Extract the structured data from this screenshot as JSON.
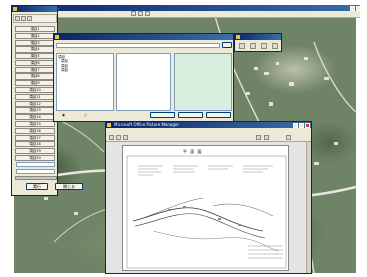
{
  "main_window": {
    "title": "地図情報閲覧システム",
    "menu": [],
    "side_tabs": [
      "項目1",
      "項目2",
      "項目3",
      "項目4",
      "項目5",
      "項目6",
      "項目7",
      "項目8",
      "項目9",
      "項目10",
      "項目11",
      "項目12",
      "項目13",
      "項目14",
      "項目15",
      "項目16",
      "項目17",
      "項目18",
      "項目19",
      "項目20"
    ],
    "left_field_values": [
      "",
      ""
    ],
    "ok_label": "実行",
    "close_label": "閉じる"
  },
  "dialog": {
    "title": "",
    "path_value": "",
    "tree_items": [
      "項目",
      "項目",
      "項目",
      "項目"
    ],
    "selected_item": "",
    "radio_a": "",
    "radio_b": "",
    "btn1": "",
    "btn2": "",
    "btn3": ""
  },
  "viewer": {
    "title": "Microsoft Office Picture Manager",
    "menu": [],
    "drawing_title": "平 面 図"
  },
  "colors": {
    "titlebar": "#0a246a",
    "selection": "#316ac5",
    "preview_fill": "#d8efe0"
  }
}
